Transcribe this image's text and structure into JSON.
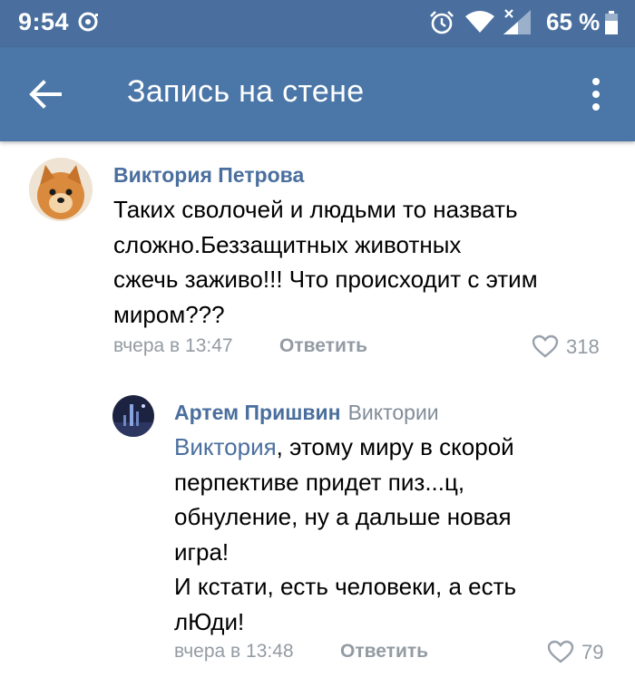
{
  "status_bar": {
    "time": "9:54",
    "battery": "65 %",
    "icons": [
      "notification-icon",
      "alarm-icon",
      "wifi-icon",
      "signal-icon",
      "battery-icon"
    ]
  },
  "header": {
    "title": "Запись на стене",
    "icons": [
      "back-arrow-icon",
      "more-vertical-icon"
    ]
  },
  "comments": [
    {
      "author": "Виктория Петрова",
      "text_lines": [
        "Таких сволочей и людьми то назвать",
        "сложно.Беззащитных животных",
        "сжечь заживо!!! Что происходит с этим",
        "миром???"
      ],
      "date": "вчера в 13:47",
      "reply_label": "Ответить",
      "likes": "318"
    },
    {
      "author": "Артем Пришвин",
      "reply_to": "Виктории",
      "mention": "Виктория",
      "text_lines": [
        ", этому миру в скорой",
        "перпективе придет пиз...ц,",
        "обнуление, ну а дальше новая",
        "игра!",
        "И кстати, есть человеки, а есть",
        "лЮди!"
      ],
      "date": "вчера в 13:48",
      "reply_label": "Ответить",
      "likes": "79"
    }
  ],
  "colors": {
    "status_bar": "#4a6f9e",
    "app_bar": "#4a76a8",
    "link": "#4a6f9e",
    "secondary": "#939ba3"
  }
}
